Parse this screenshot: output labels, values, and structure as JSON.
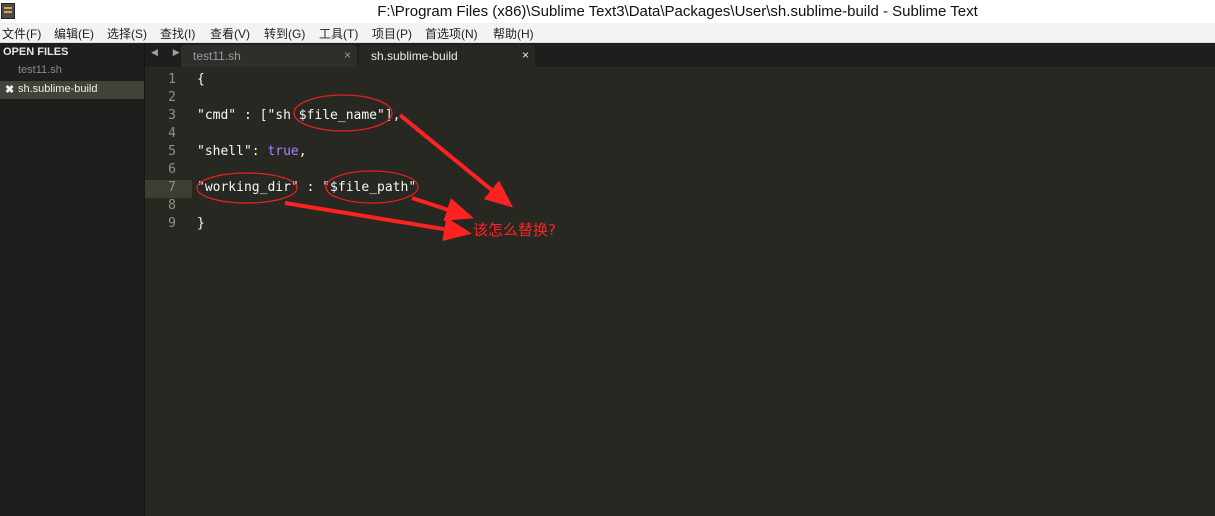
{
  "window": {
    "title": "F:\\Program Files (x86)\\Sublime Text3\\Data\\Packages\\User\\sh.sublime-build - Sublime Text"
  },
  "menu": [
    "文件(F)",
    "编辑(E)",
    "选择(S)",
    "查找(I)",
    "查看(V)",
    "转到(G)",
    "工具(T)",
    "项目(P)",
    "首选项(N)",
    "帮助(H)"
  ],
  "sidebar": {
    "header": "OPEN FILES",
    "files": [
      {
        "name": "test11.sh"
      },
      {
        "name": "sh.sublime-build",
        "close": "✖"
      }
    ]
  },
  "tabs": {
    "arrows": "◀ ▶",
    "items": [
      {
        "label": "test11.sh",
        "close": "×"
      },
      {
        "label": "sh.sublime-build",
        "close": "×"
      }
    ]
  },
  "editor": {
    "line_numbers": [
      "1",
      "2",
      "3",
      "4",
      "5",
      "6",
      "7",
      "8",
      "9"
    ],
    "line1": "{",
    "line3": "\"cmd\" : [\"sh $file_name\"],",
    "line5a": "\"shell\": ",
    "line5b": "true",
    "line5c": ",",
    "line7": "\"working_dir\" : \"$file_path\"",
    "line9": "}"
  },
  "annotation": {
    "text": "该怎么替换?",
    "color": "#ff2222"
  }
}
